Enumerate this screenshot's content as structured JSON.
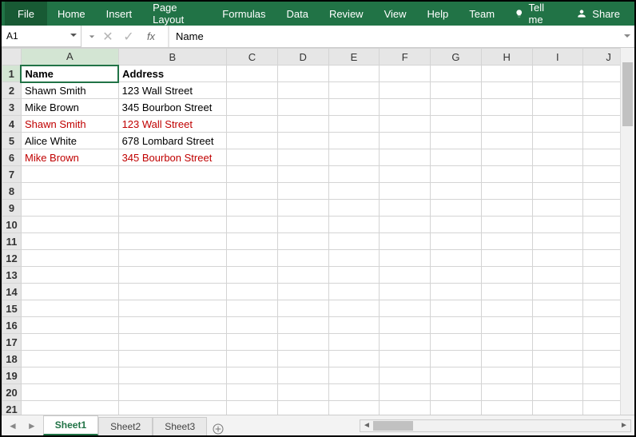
{
  "ribbon": {
    "file": "File",
    "tabs": [
      "Home",
      "Insert",
      "Page Layout",
      "Formulas",
      "Data",
      "Review",
      "View",
      "Help",
      "Team"
    ],
    "tellme": "Tell me",
    "share": "Share"
  },
  "namebox": {
    "ref": "A1"
  },
  "formula_bar": {
    "value": "Name"
  },
  "columns": [
    "A",
    "B",
    "C",
    "D",
    "E",
    "F",
    "G",
    "H",
    "I",
    "J"
  ],
  "row_count": 21,
  "selected_cell": {
    "row": 1,
    "col": "A"
  },
  "cells": {
    "A1": {
      "v": "Name",
      "bold": true
    },
    "B1": {
      "v": "Address",
      "bold": true
    },
    "A2": {
      "v": "Shawn Smith"
    },
    "B2": {
      "v": "123 Wall Street"
    },
    "A3": {
      "v": "Mike Brown"
    },
    "B3": {
      "v": "345 Bourbon Street"
    },
    "A4": {
      "v": "Shawn Smith",
      "red": true
    },
    "B4": {
      "v": "123 Wall Street",
      "red": true
    },
    "A5": {
      "v": "Alice White"
    },
    "B5": {
      "v": "678 Lombard Street"
    },
    "A6": {
      "v": "Mike Brown",
      "red": true
    },
    "B6": {
      "v": "345 Bourbon Street",
      "red": true
    }
  },
  "sheet_tabs": {
    "active": "Sheet1",
    "list": [
      "Sheet1",
      "Sheet2",
      "Sheet3"
    ]
  },
  "chart_data": {
    "type": "table",
    "headers": [
      "Name",
      "Address"
    ],
    "rows": [
      {
        "Name": "Shawn Smith",
        "Address": "123 Wall Street",
        "highlight": false
      },
      {
        "Name": "Mike Brown",
        "Address": "345 Bourbon Street",
        "highlight": false
      },
      {
        "Name": "Shawn Smith",
        "Address": "123 Wall Street",
        "highlight": true
      },
      {
        "Name": "Alice White",
        "Address": "678 Lombard Street",
        "highlight": false
      },
      {
        "Name": "Mike Brown",
        "Address": "345 Bourbon Street",
        "highlight": true
      }
    ],
    "note": "highlight=true rows shown in red (duplicates)"
  }
}
